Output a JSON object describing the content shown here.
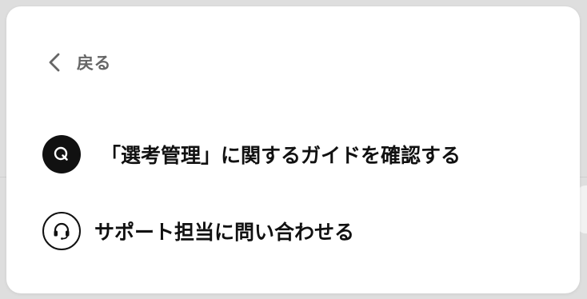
{
  "back": {
    "label": "戻る",
    "icon": "chevron-left-icon"
  },
  "menu": {
    "items": [
      {
        "label": "「選考管理」に関するガイドを確認する",
        "icon": "q-guide-icon"
      },
      {
        "label": "サポート担当に問い合わせる",
        "icon": "headset-icon"
      }
    ]
  },
  "colors": {
    "panel_background": "#ffffff",
    "text_primary": "#111111",
    "text_secondary": "#666666"
  }
}
